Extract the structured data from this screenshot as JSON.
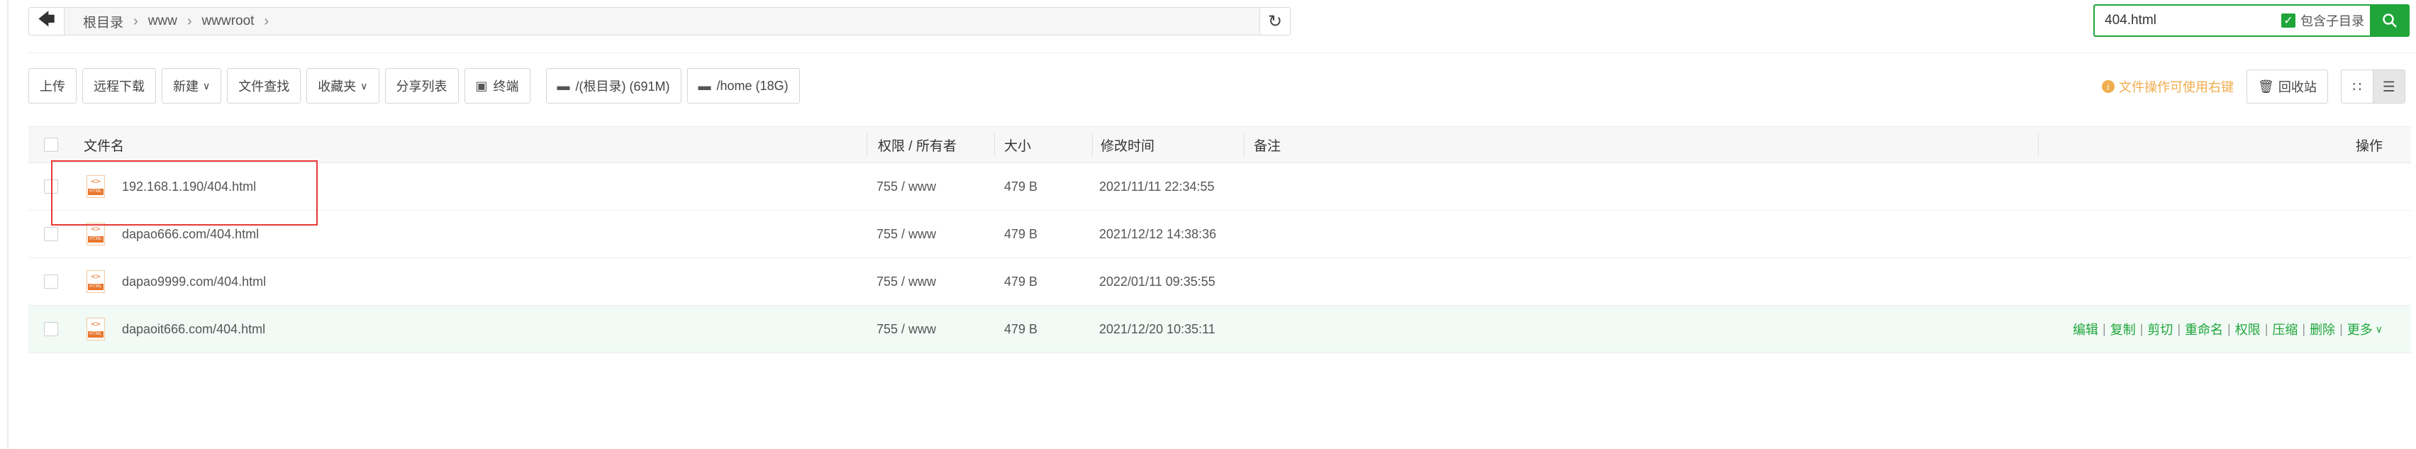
{
  "breadcrumb": {
    "items": [
      "根目录",
      "www",
      "wwwroot"
    ]
  },
  "search": {
    "value": "404.html",
    "include_subdir_label": "包含子目录",
    "include_subdir_checked": true
  },
  "toolbar": {
    "upload": "上传",
    "remote_download": "远程下载",
    "new": "新建",
    "find_in_files": "文件查找",
    "favorites": "收藏夹",
    "share_list": "分享列表",
    "terminal": "终端",
    "disk_root": "/(根目录) (691M)",
    "disk_home": "/home (18G)"
  },
  "right_tools": {
    "hint": "文件操作可使用右键",
    "recycle_bin": "回收站"
  },
  "table": {
    "columns": {
      "name": "文件名",
      "perm": "权限 / 所有者",
      "size": "大小",
      "mtime": "修改时间",
      "note": "备注",
      "ops": "操作"
    },
    "rows": [
      {
        "name": "192.168.1.190/404.html",
        "perm": "755 / www",
        "size": "479 B",
        "mtime": "2021/11/11 22:34:55"
      },
      {
        "name": "dapao666.com/404.html",
        "perm": "755 / www",
        "size": "479 B",
        "mtime": "2021/12/12 14:38:36"
      },
      {
        "name": "dapao9999.com/404.html",
        "perm": "755 / www",
        "size": "479 B",
        "mtime": "2022/01/11 09:35:55"
      },
      {
        "name": "dapaoit666.com/404.html",
        "perm": "755 / www",
        "size": "479 B",
        "mtime": "2021/12/20 10:35:11"
      }
    ],
    "row_actions": [
      "编辑",
      "复制",
      "剪切",
      "重命名",
      "权限",
      "压缩",
      "删除",
      "更多"
    ]
  },
  "file_icon": {
    "glyph": "<>",
    "band": "HTML"
  },
  "colors": {
    "accent": "#20a53a",
    "warning": "#f0ad4e",
    "highlight_box": "#e53935"
  },
  "icons": {
    "back": "arrow-left-icon",
    "refresh": "refresh-icon",
    "search": "search-icon",
    "terminal": "terminal-icon",
    "disk": "disk-icon",
    "recycle": "trash-icon",
    "grid_view": "grid-view-icon",
    "list_view": "list-view-icon",
    "info": "info-icon"
  }
}
